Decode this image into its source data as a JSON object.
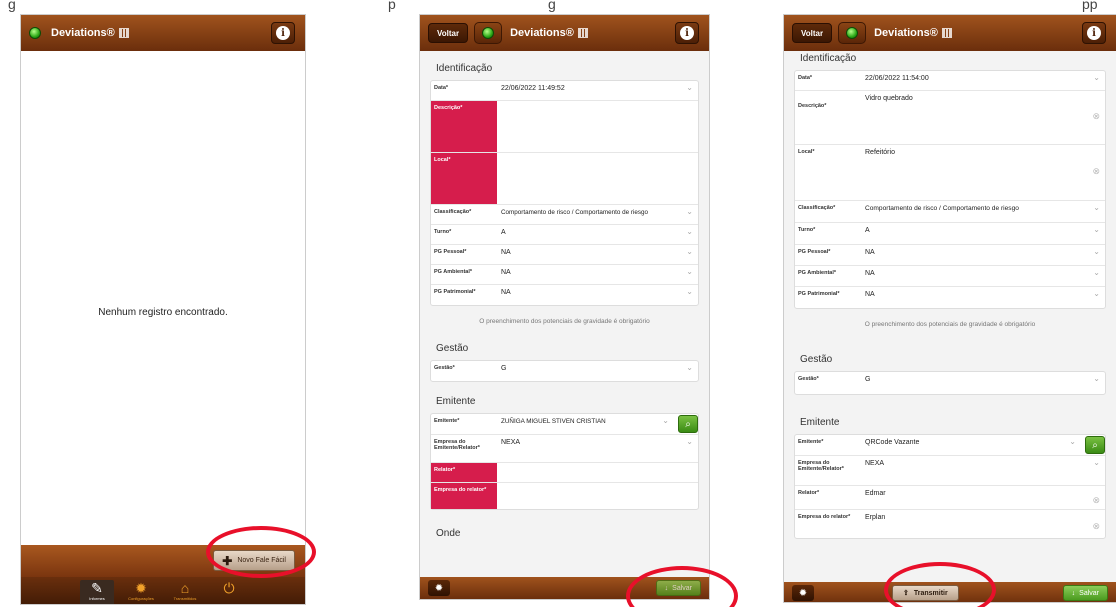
{
  "caption": {
    "part1": "g",
    "part2": "p",
    "part3": "g",
    "part4": "pp"
  },
  "colors": {
    "header_brown": "#8a4415",
    "error_red": "#d61d4c",
    "save_green": "#4b9b1f",
    "highlight_circle": "#e8102a"
  },
  "app": {
    "title": "Deviations®",
    "back_label": "Voltar",
    "info_icon": "info-icon",
    "status_led": "green"
  },
  "screen1": {
    "empty_message": "Nenhum registro encontrado.",
    "new_button": "Novo Fale Fácil",
    "tabs": [
      {
        "label": "Informes",
        "icon": "edit-icon",
        "glyph": "✎"
      },
      {
        "label": "Configurações",
        "icon": "gear-icon",
        "glyph": "✹"
      },
      {
        "label": "Transmitidos",
        "icon": "inbox-icon",
        "glyph": "⌂"
      },
      {
        "label": "",
        "icon": "power-icon",
        "glyph": "⏻"
      }
    ]
  },
  "screen2": {
    "identificacao": {
      "heading": "Identificação",
      "data_label": "Data*",
      "data_value": "22/06/2022 11:49:52",
      "descricao_label": "Descrição*",
      "descricao_value": "",
      "local_label": "Local*",
      "local_value": "",
      "classificacao_label": "Classificação*",
      "classificacao_value": "Comportamento de risco / Comportamento de riesgo",
      "turno_label": "Turno*",
      "turno_value": "A",
      "pg_pessoal_label": "PG Pessoal*",
      "pg_pessoal_value": "NA",
      "pg_ambiental_label": "PG Ambiental*",
      "pg_ambiental_value": "NA",
      "pg_patrimonial_label": "PG Patrimonial*",
      "pg_patrimonial_value": "NA",
      "note": "O preenchimento dos potenciais de gravidade é obrigatório"
    },
    "gestao": {
      "heading": "Gestão",
      "label": "Gestão*",
      "value": "G"
    },
    "emitente": {
      "heading": "Emitente",
      "emitente_label": "Emitente*",
      "emitente_value": "ZUÑIGA MIGUEL STIVEN CRISTIAN",
      "empresa_label": "Empresa do Emitente/Relator*",
      "empresa_value": "NEXA",
      "relator_label": "Relator*",
      "relator_value": "",
      "empresa_relator_label": "Empresa do relator*",
      "empresa_relator_value": ""
    },
    "onde": {
      "heading": "Onde"
    },
    "save_label": "Salvar"
  },
  "screen3": {
    "identificacao": {
      "heading": "Identificação",
      "data_label": "Data*",
      "data_value": "22/06/2022 11:54:00",
      "descricao_label": "Descrição*",
      "descricao_value": "Vidro quebrado",
      "local_label": "Local*",
      "local_value": "Refeitório",
      "classificacao_label": "Classificação*",
      "classificacao_value": "Comportamento de risco / Comportamento de riesgo",
      "turno_label": "Turno*",
      "turno_value": "A",
      "pg_pessoal_label": "PG Pessoal*",
      "pg_pessoal_value": "NA",
      "pg_ambiental_label": "PG Ambiental*",
      "pg_ambiental_value": "NA",
      "pg_patrimonial_label": "PG Patrimonial*",
      "pg_patrimonial_value": "NA",
      "note": "O preenchimento dos potenciais de gravidade é obrigatório"
    },
    "gestao": {
      "heading": "Gestão",
      "label": "Gestão*",
      "value": "G"
    },
    "emitente": {
      "heading": "Emitente",
      "emitente_label": "Emitente*",
      "emitente_value": "QRCode Vazante",
      "empresa_label": "Empresa do Emitente/Relator*",
      "empresa_value": "NEXA",
      "relator_label": "Relator*",
      "relator_value": "Edmar",
      "empresa_relator_label": "Empresa do relator*",
      "empresa_relator_value": "Erplan"
    },
    "transmit_label": "Transmitir",
    "save_label": "Salvar"
  }
}
